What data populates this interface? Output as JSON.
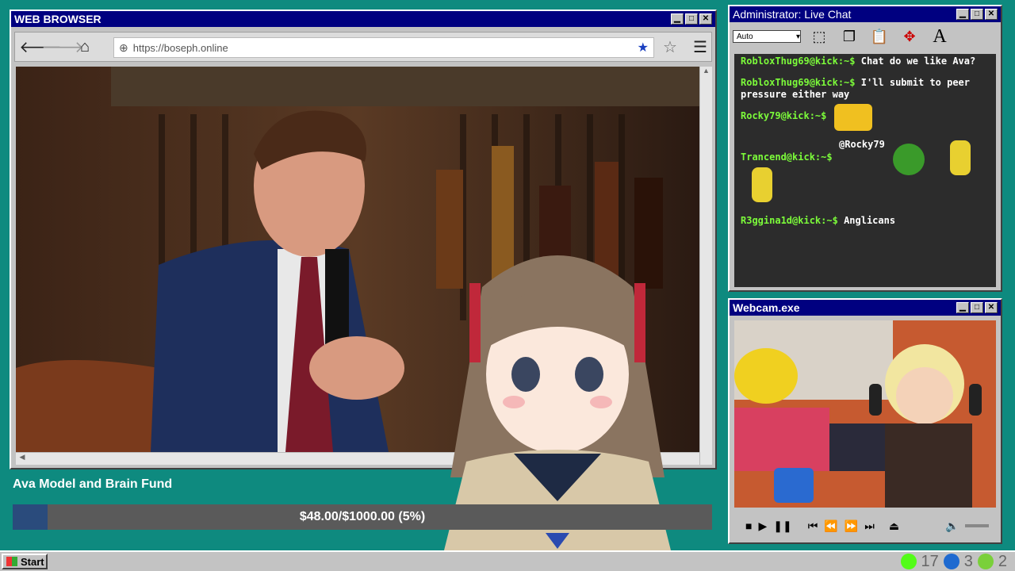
{
  "browser": {
    "title": "WEB BROWSER",
    "url": "https://boseph.online"
  },
  "chat": {
    "title": "Administrator: Live Chat",
    "font_select": "Auto",
    "messages": [
      {
        "user": "RobloxThug69@kick:~$",
        "text": "Chat do we like Ava?"
      },
      {
        "user": "RobloxThug69@kick:~$",
        "text": "I'll submit to peer pressure either way"
      },
      {
        "user": "Rocky79@kick:~$",
        "text": ""
      },
      {
        "user": "Trancend@kick:~$",
        "text": "@Rocky79"
      },
      {
        "user": "R3ggina1d@kick:~$",
        "text": "Anglicans"
      }
    ]
  },
  "webcam": {
    "title": "Webcam.exe"
  },
  "fund": {
    "title": "Ava Model and Brain Fund",
    "progress_text": "$48.00/$1000.00 (5%)",
    "progress": 0.05
  },
  "taskbar": {
    "start_label": "Start",
    "tray": [
      {
        "icon": "kick-icon",
        "count": "17"
      },
      {
        "icon": "moon-icon",
        "count": "3"
      },
      {
        "icon": "play-icon",
        "count": "2"
      }
    ]
  },
  "colors": {
    "desktop": "#0e8a7f",
    "titlebar": "#000080",
    "chat_user": "#7CFC3a"
  }
}
